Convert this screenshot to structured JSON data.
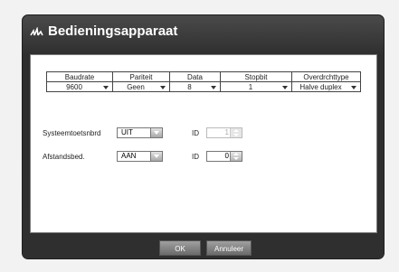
{
  "dialog": {
    "title": "Bedieningsapparaat"
  },
  "table": {
    "headers": [
      "Baudrate",
      "Pariteit",
      "Data",
      "Stopbit",
      "Overdrchttype"
    ],
    "values": [
      "9600",
      "Geen",
      "8",
      "1",
      "Halve duplex"
    ]
  },
  "system_keyboard": {
    "label": "Systeemtoetsnbrd",
    "value": "UIT",
    "id_label": "ID",
    "id_value": "1",
    "id_disabled": true
  },
  "remote_control": {
    "label": "Afstandsbed.",
    "value": "AAN",
    "id_label": "ID",
    "id_value": "0"
  },
  "footer": {
    "ok_label": "OK",
    "cancel_label": "Annuleer"
  },
  "icons": {
    "title_icon": "signal-wave-icon"
  }
}
